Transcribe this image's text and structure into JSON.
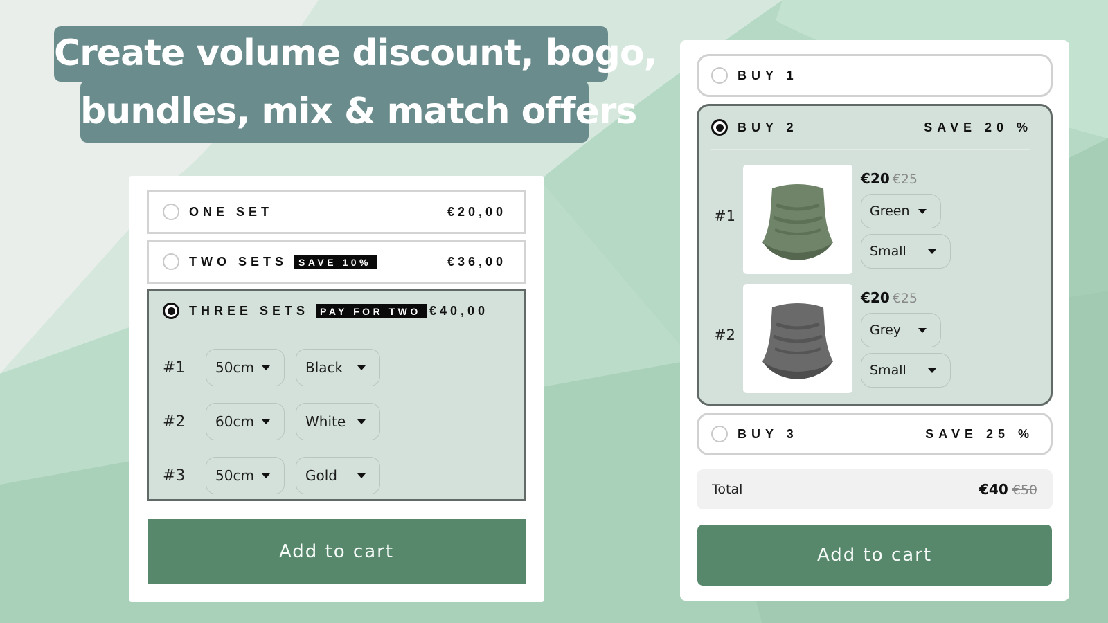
{
  "headline": {
    "line1": "Create volume discount, bogo,",
    "line2": "bundles, mix & match offers"
  },
  "colors": {
    "accent": "#57886c",
    "headline_bg": "#6b8c8c",
    "selected_bg": "#d3e1da",
    "badge_bg": "#0a0a0a"
  },
  "left_widget": {
    "options": [
      {
        "label": "ONE SET",
        "badge": "",
        "price": "€20,00",
        "selected": false
      },
      {
        "label": "TWO SETS",
        "badge": "SAVE 10%",
        "price": "€36,00",
        "selected": false
      },
      {
        "label": "THREE SETS",
        "badge": "PAY FOR TWO",
        "price": "€40,00",
        "selected": true
      }
    ],
    "sets": [
      {
        "num": "#1",
        "size": "50cm",
        "color": "Black"
      },
      {
        "num": "#2",
        "size": "60cm",
        "color": "White"
      },
      {
        "num": "#3",
        "size": "50cm",
        "color": "Gold"
      }
    ],
    "add_to_cart": "Add to cart"
  },
  "right_widget": {
    "options": [
      {
        "label": "BUY 1",
        "save": "",
        "selected": false
      },
      {
        "label": "BUY 2",
        "save": "SAVE 20 %",
        "selected": true
      },
      {
        "label": "BUY 3",
        "save": "SAVE 25 %",
        "selected": false
      }
    ],
    "items": [
      {
        "num": "#1",
        "price": "€20",
        "old_price": "€25",
        "color": "Green",
        "size": "Small",
        "image": "green-neck-gaiter"
      },
      {
        "num": "#2",
        "price": "€20",
        "old_price": "€25",
        "color": "Grey",
        "size": "Small",
        "image": "grey-neck-gaiter"
      }
    ],
    "total": {
      "label": "Total",
      "price": "€40",
      "old_price": "€50"
    },
    "add_to_cart": "Add to cart"
  }
}
